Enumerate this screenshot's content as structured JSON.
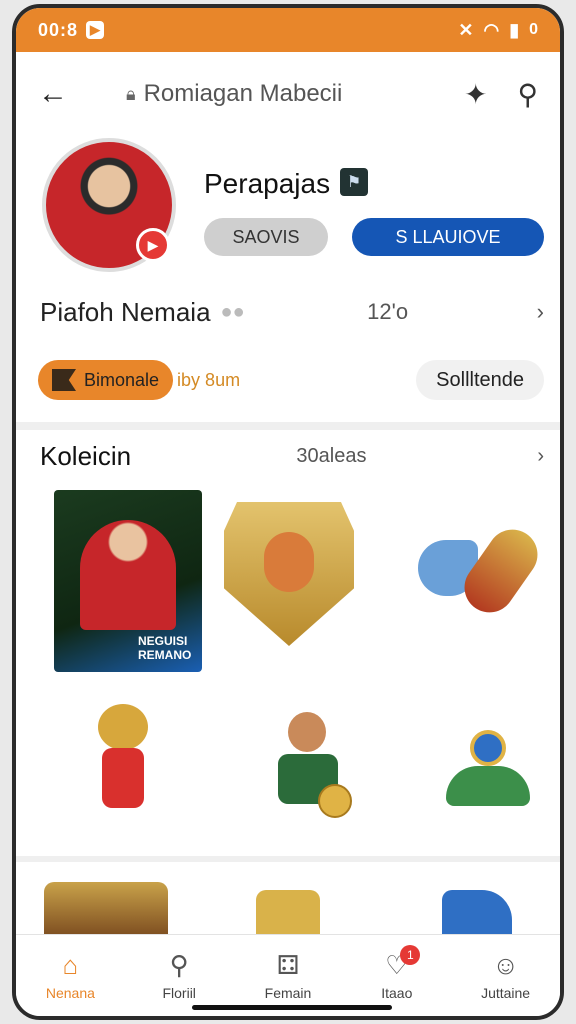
{
  "status_bar": {
    "time": "00:8",
    "notif_icon": "notification-icon",
    "right_text": "0"
  },
  "header": {
    "title": "Romiagan Mabecii",
    "back_icon": "back-arrow-icon",
    "lock_icon": "lock-icon",
    "gift_icon": "gift-icon",
    "search_icon": "search-icon"
  },
  "profile": {
    "name": "Perapajas",
    "button_gray": "SAOVIS",
    "button_blue": "S LLAUIOVE",
    "badge_icon": "verified-badge-icon"
  },
  "stats": {
    "label": "Piafoh Nemaia",
    "count": "12'o"
  },
  "actions": {
    "orange_pill": "Bimonale",
    "orange_sub": "iby 8um",
    "outline_pill": "Sollltende"
  },
  "collection": {
    "title": "Koleicin",
    "more": "30aleas"
  },
  "cards": {
    "card1_tag_line1": "NEGUISI",
    "card1_tag_line2": "REMANO"
  },
  "nav": {
    "items": [
      {
        "label": "Nenana",
        "icon": "home-icon"
      },
      {
        "label": "Floriil",
        "icon": "search-icon"
      },
      {
        "label": "Femain",
        "icon": "dice-icon"
      },
      {
        "label": "Itaao",
        "icon": "heart-icon",
        "badge": "1"
      },
      {
        "label": "Juttaine",
        "icon": "profile-icon"
      }
    ]
  },
  "colors": {
    "accent": "#e8862a",
    "primary_blue": "#1556b5"
  }
}
